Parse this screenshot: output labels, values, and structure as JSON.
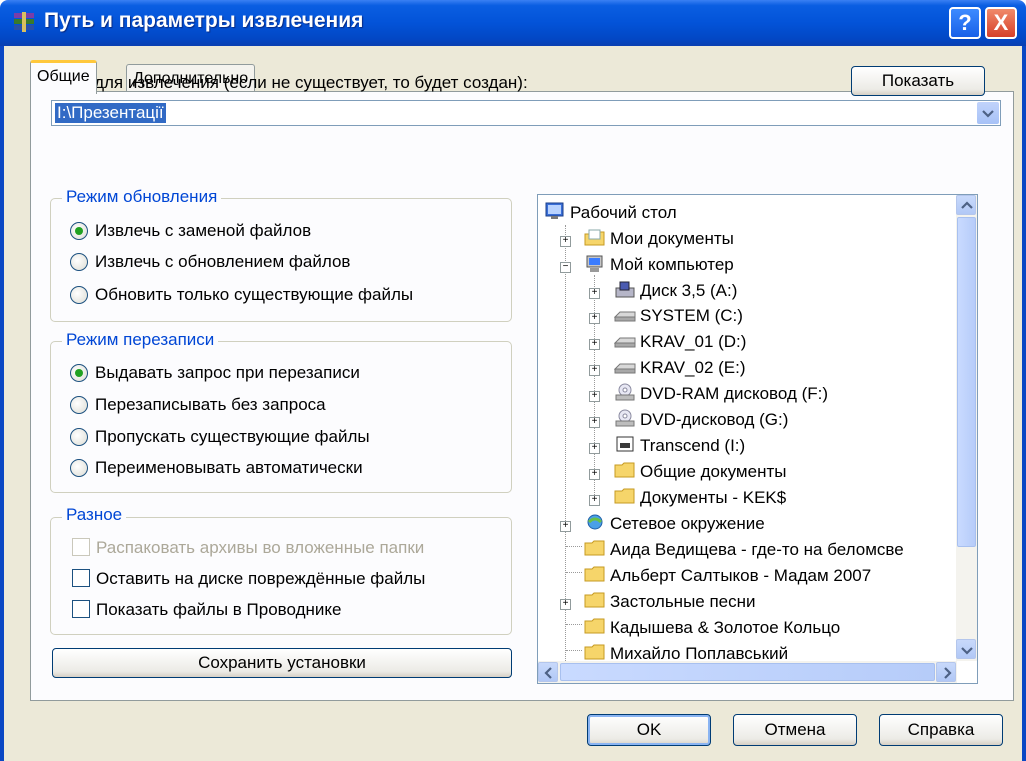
{
  "window": {
    "title": "Путь и параметры извлечения",
    "help_label": "?",
    "close_label": "X"
  },
  "tabs": [
    {
      "label": "Общие",
      "active": true
    },
    {
      "label": "Дополнительно",
      "active": false
    }
  ],
  "path": {
    "label": "Путь для извлечения (если не существует, то будет создан):",
    "value": "I:\\Презентації",
    "show_button": "Показать"
  },
  "update_mode": {
    "title": "Режим обновления",
    "options": [
      {
        "label": "Извлечь с заменой файлов",
        "selected": true
      },
      {
        "label": "Извлечь с обновлением файлов",
        "selected": false
      },
      {
        "label": "Обновить только существующие файлы",
        "selected": false
      }
    ]
  },
  "overwrite_mode": {
    "title": "Режим перезаписи",
    "options": [
      {
        "label": "Выдавать запрос при перезаписи",
        "selected": true
      },
      {
        "label": "Перезаписывать без запроса",
        "selected": false
      },
      {
        "label": "Пропускать существующие файлы",
        "selected": false
      },
      {
        "label": "Переименовывать автоматически",
        "selected": false
      }
    ]
  },
  "misc": {
    "title": "Разное",
    "options": [
      {
        "label": "Распаковать архивы во вложенные папки",
        "checked": false,
        "disabled": true
      },
      {
        "label": "Оставить на диске повреждённые файлы",
        "checked": false,
        "disabled": false
      },
      {
        "label": "Показать файлы в Проводнике",
        "checked": false,
        "disabled": false
      }
    ]
  },
  "save_button": "Сохранить установки",
  "tree": {
    "items": [
      {
        "label": "Рабочий стол",
        "icon": "desktop-icon"
      },
      {
        "label": "Мои документы",
        "icon": "my-documents-icon"
      },
      {
        "label": "Мой компьютер",
        "icon": "my-computer-icon"
      },
      {
        "label": "Диск 3,5 (A:)",
        "icon": "floppy-drive-icon"
      },
      {
        "label": "SYSTEM (C:)",
        "icon": "hard-drive-icon"
      },
      {
        "label": "KRAV_01 (D:)",
        "icon": "hard-drive-icon"
      },
      {
        "label": "KRAV_02 (E:)",
        "icon": "hard-drive-icon"
      },
      {
        "label": "DVD-RAM дисковод (F:)",
        "icon": "dvd-drive-icon"
      },
      {
        "label": "DVD-дисковод (G:)",
        "icon": "dvd-drive-icon"
      },
      {
        "label": "Transcend (I:)",
        "icon": "removable-drive-icon"
      },
      {
        "label": "Общие документы",
        "icon": "folder-icon"
      },
      {
        "label": "Документы - KEK$",
        "icon": "folder-icon"
      },
      {
        "label": "Сетевое окружение",
        "icon": "network-icon"
      },
      {
        "label": "Аида Ведищева - где-то на беломсве",
        "icon": "folder-icon"
      },
      {
        "label": "Альберт Салтыков - Мадам 2007",
        "icon": "folder-icon"
      },
      {
        "label": "Застольные песни",
        "icon": "folder-icon"
      },
      {
        "label": "Кадышева & Золотое Кольцо",
        "icon": "folder-icon"
      },
      {
        "label": "Михайло Поплавський",
        "icon": "folder-icon"
      }
    ]
  },
  "footer": {
    "ok": "OK",
    "cancel": "Отмена",
    "help": "Справка"
  },
  "colors": {
    "titlebar": "#0353d8",
    "window_bg": "#ece9d8",
    "group_title": "#0046d5",
    "selection": "#316ac5"
  }
}
